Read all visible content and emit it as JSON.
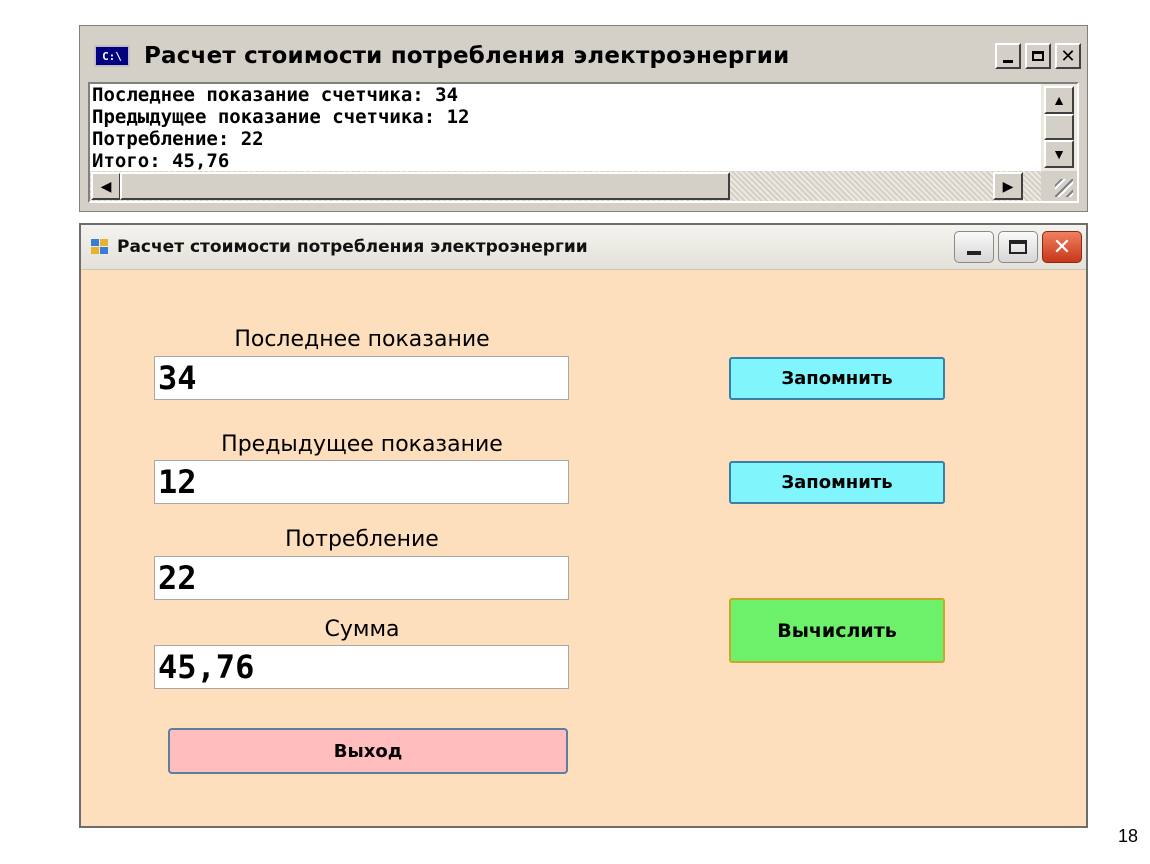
{
  "console": {
    "title": "Расчет стоимости потребления электроэнергии",
    "icon": "console-icon",
    "icon_text": "C:\\",
    "lines": [
      "Последнее показание счетчика: 34",
      "Предыдущее показание счетчика: 12",
      "Потребление: 22",
      "Итого: 45,76"
    ]
  },
  "form": {
    "title": "Расчет стоимости потребления электроэнергии",
    "icon": "app-icon",
    "background_color": "#fddfbe",
    "fields": [
      {
        "label": "Последнее показание",
        "value": "34"
      },
      {
        "label": "Предыдущее показание",
        "value": "12"
      },
      {
        "label": "Потребление",
        "value": "22"
      },
      {
        "label": "Сумма",
        "value": "45,76"
      }
    ],
    "buttons": {
      "remember_1": "Запомнить",
      "remember_2": "Запомнить",
      "calculate": "Вычислить",
      "exit": "Выход"
    },
    "colors": {
      "remember": "#80f5fb",
      "calculate": "#6ef16a",
      "exit": "#ffbdbd"
    }
  },
  "slide_number": "18"
}
